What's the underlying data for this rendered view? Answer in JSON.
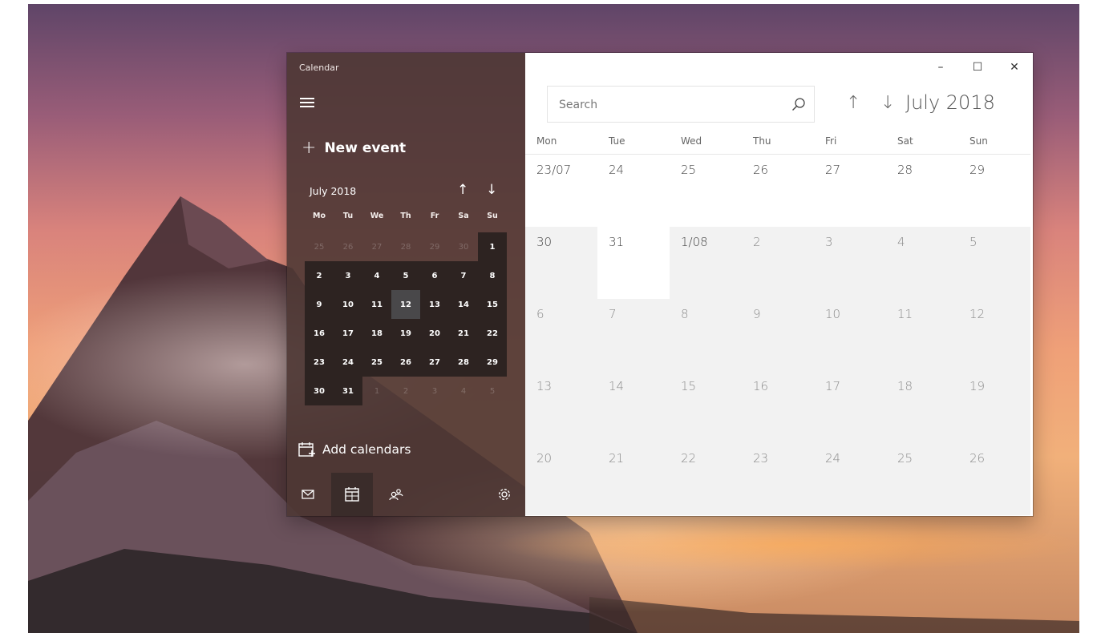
{
  "app": {
    "title": "Calendar"
  },
  "sidebar": {
    "new_event_label": "New event",
    "mini_calendar": {
      "month_label": "July 2018",
      "up_arrow": "↑",
      "down_arrow": "↓",
      "weekdays": [
        "Mo",
        "Tu",
        "We",
        "Th",
        "Fr",
        "Sa",
        "Su"
      ],
      "days": [
        {
          "n": "25",
          "s": "adj"
        },
        {
          "n": "26",
          "s": "adj"
        },
        {
          "n": "27",
          "s": "adj"
        },
        {
          "n": "28",
          "s": "adj"
        },
        {
          "n": "29",
          "s": "adj"
        },
        {
          "n": "30",
          "s": "adj"
        },
        {
          "n": "1",
          "s": "cur"
        },
        {
          "n": "2",
          "s": "cur"
        },
        {
          "n": "3",
          "s": "cur"
        },
        {
          "n": "4",
          "s": "cur"
        },
        {
          "n": "5",
          "s": "cur"
        },
        {
          "n": "6",
          "s": "cur"
        },
        {
          "n": "7",
          "s": "cur"
        },
        {
          "n": "8",
          "s": "cur"
        },
        {
          "n": "9",
          "s": "cur"
        },
        {
          "n": "10",
          "s": "cur"
        },
        {
          "n": "11",
          "s": "cur"
        },
        {
          "n": "12",
          "s": "today"
        },
        {
          "n": "13",
          "s": "cur"
        },
        {
          "n": "14",
          "s": "cur"
        },
        {
          "n": "15",
          "s": "cur"
        },
        {
          "n": "16",
          "s": "cur"
        },
        {
          "n": "17",
          "s": "cur"
        },
        {
          "n": "18",
          "s": "cur"
        },
        {
          "n": "19",
          "s": "cur"
        },
        {
          "n": "20",
          "s": "cur"
        },
        {
          "n": "21",
          "s": "cur"
        },
        {
          "n": "22",
          "s": "cur"
        },
        {
          "n": "23",
          "s": "cur"
        },
        {
          "n": "24",
          "s": "cur"
        },
        {
          "n": "25",
          "s": "cur"
        },
        {
          "n": "26",
          "s": "cur"
        },
        {
          "n": "27",
          "s": "cur"
        },
        {
          "n": "28",
          "s": "cur"
        },
        {
          "n": "29",
          "s": "cur"
        },
        {
          "n": "30",
          "s": "cur"
        },
        {
          "n": "31",
          "s": "cur"
        },
        {
          "n": "1",
          "s": "adj"
        },
        {
          "n": "2",
          "s": "adj"
        },
        {
          "n": "3",
          "s": "adj"
        },
        {
          "n": "4",
          "s": "adj"
        },
        {
          "n": "5",
          "s": "adj"
        }
      ]
    },
    "add_calendars_label": "Add calendars",
    "bottom_nav": [
      {
        "name": "mail",
        "icon": "mail-icon",
        "active": false
      },
      {
        "name": "calendar",
        "icon": "calendar-icon",
        "active": true
      },
      {
        "name": "people",
        "icon": "people-icon",
        "active": false
      },
      {
        "name": "settings",
        "icon": "gear-icon",
        "active": false
      }
    ]
  },
  "main": {
    "search_placeholder": "Search",
    "up_arrow": "↑",
    "down_arrow": "↓",
    "month_title": "July 2018",
    "window_controls": {
      "minimize": "–",
      "maximize": "☐",
      "close": "✕"
    },
    "weekdays": [
      "Mon",
      "Tue",
      "Wed",
      "Thu",
      "Fri",
      "Sat",
      "Sun"
    ],
    "days": [
      {
        "n": "23/07",
        "s": "cur",
        "bg": "w"
      },
      {
        "n": "24",
        "s": "cur",
        "bg": "w"
      },
      {
        "n": "25",
        "s": "cur",
        "bg": "w"
      },
      {
        "n": "26",
        "s": "cur",
        "bg": "w"
      },
      {
        "n": "27",
        "s": "cur",
        "bg": "w"
      },
      {
        "n": "28",
        "s": "cur",
        "bg": "w"
      },
      {
        "n": "29",
        "s": "cur",
        "bg": "w"
      },
      {
        "n": "30",
        "s": "cur",
        "bg": "g"
      },
      {
        "n": "31",
        "s": "cur",
        "bg": "w"
      },
      {
        "n": "1/08",
        "s": "cur",
        "bg": "g"
      },
      {
        "n": "2",
        "s": "adj",
        "bg": "g"
      },
      {
        "n": "3",
        "s": "adj",
        "bg": "g"
      },
      {
        "n": "4",
        "s": "adj",
        "bg": "g"
      },
      {
        "n": "5",
        "s": "adj",
        "bg": "g"
      },
      {
        "n": "6",
        "s": "adj",
        "bg": "g"
      },
      {
        "n": "7",
        "s": "adj",
        "bg": "g"
      },
      {
        "n": "8",
        "s": "adj",
        "bg": "g"
      },
      {
        "n": "9",
        "s": "adj",
        "bg": "g"
      },
      {
        "n": "10",
        "s": "adj",
        "bg": "g"
      },
      {
        "n": "11",
        "s": "adj",
        "bg": "g"
      },
      {
        "n": "12",
        "s": "adj",
        "bg": "g"
      },
      {
        "n": "13",
        "s": "adj",
        "bg": "g"
      },
      {
        "n": "14",
        "s": "adj",
        "bg": "g"
      },
      {
        "n": "15",
        "s": "adj",
        "bg": "g"
      },
      {
        "n": "16",
        "s": "adj",
        "bg": "g"
      },
      {
        "n": "17",
        "s": "adj",
        "bg": "g"
      },
      {
        "n": "18",
        "s": "adj",
        "bg": "g"
      },
      {
        "n": "19",
        "s": "adj",
        "bg": "g"
      },
      {
        "n": "20",
        "s": "adj",
        "bg": "g"
      },
      {
        "n": "21",
        "s": "adj",
        "bg": "g"
      },
      {
        "n": "22",
        "s": "adj",
        "bg": "g"
      },
      {
        "n": "23",
        "s": "adj",
        "bg": "g"
      },
      {
        "n": "24",
        "s": "adj",
        "bg": "g"
      },
      {
        "n": "25",
        "s": "adj",
        "bg": "g"
      },
      {
        "n": "26",
        "s": "adj",
        "bg": "g"
      }
    ]
  }
}
